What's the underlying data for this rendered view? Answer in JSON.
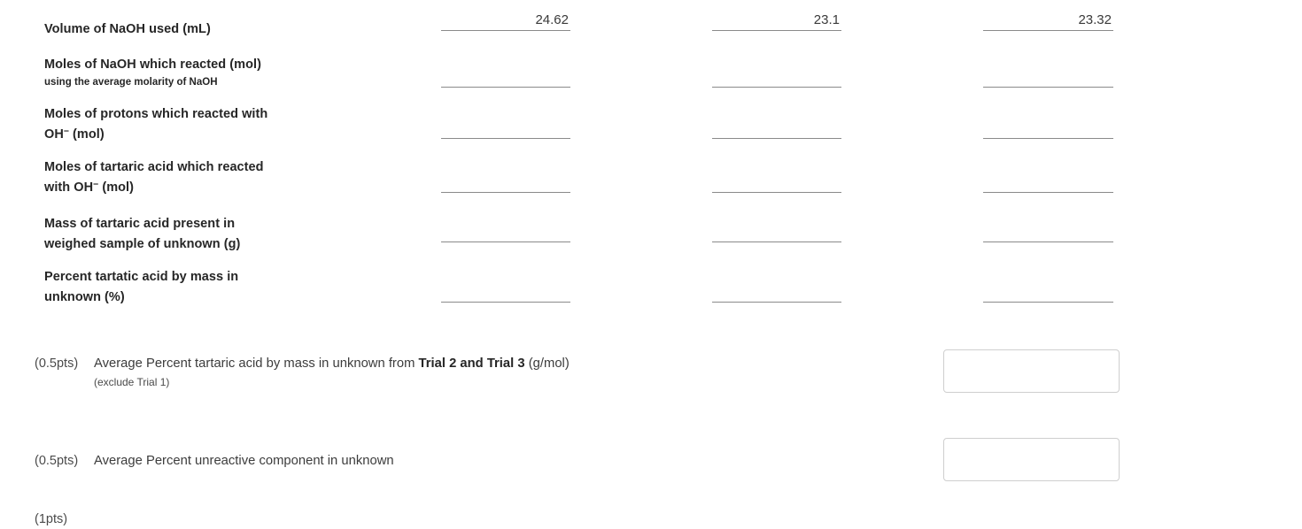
{
  "table": {
    "rows": [
      {
        "label": "Volume of NaOH used (mL)",
        "sublabel": "",
        "values": [
          "24.62",
          "23.1",
          "23.32"
        ]
      },
      {
        "label": "Moles of NaOH which reacted (mol)",
        "sublabel": "using the average molarity of NaOH",
        "values": [
          "",
          "",
          ""
        ]
      },
      {
        "label_part1": "Moles of protons which reacted with",
        "label_part2": "OH",
        "label_part3": " (mol)",
        "label": "Moles of protons which reacted with OH⁻ (mol)",
        "sublabel": "",
        "values": [
          "",
          "",
          ""
        ]
      },
      {
        "label_part1": "Moles of tartaric acid which reacted",
        "label_part2": "with OH",
        "label_part3": " (mol)",
        "label": "Moles of tartaric acid which reacted with OH⁻ (mol)",
        "sublabel": "",
        "values": [
          "",
          "",
          ""
        ]
      },
      {
        "label": "Mass of tartaric acid present in weighed sample of unknown (g)",
        "label_line1": "Mass of tartaric acid present in",
        "label_line2": "weighed sample of unknown (g)",
        "sublabel": "",
        "values": [
          "",
          "",
          ""
        ]
      },
      {
        "label": "Percent tartatic acid by mass in unknown (%)",
        "label_line1": "Percent tartatic acid by mass in",
        "label_line2": "unknown (%)",
        "sublabel": "",
        "values": [
          "",
          "",
          ""
        ]
      }
    ]
  },
  "questions": [
    {
      "points": "(0.5pts)",
      "text_before": "Average Percent tartaric acid by mass in unknown from ",
      "text_bold": "Trial 2 and Trial 3",
      "text_after": " (g/mol)",
      "note": "(exclude Trial 1)",
      "answer": "",
      "placeholder": ""
    },
    {
      "points": "(0.5pts)",
      "text_before": "Average Percent unreactive component in unknown",
      "text_bold": "",
      "text_after": "",
      "note": "",
      "answer": "",
      "placeholder": ""
    }
  ],
  "footer": {
    "clipped_points": "(1pts)"
  },
  "colors": {
    "text": "#2b2b2b",
    "muted": "#4a4a4a",
    "rule": "#8a8a8a",
    "box_border": "#cfcfcf",
    "background": "#ffffff"
  }
}
